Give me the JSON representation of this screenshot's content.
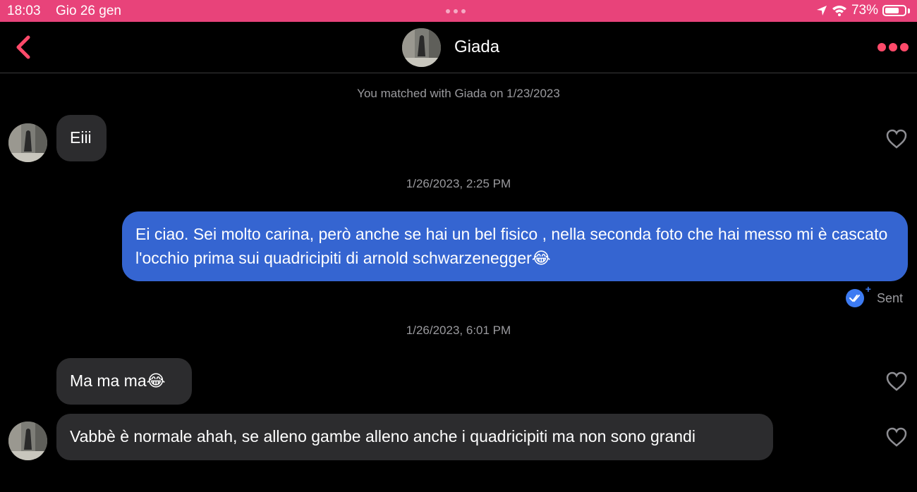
{
  "status_bar": {
    "time": "18:03",
    "date": "Gio 26 gen",
    "battery": "73%",
    "battery_level": 0.73
  },
  "header": {
    "name": "Giada"
  },
  "match_notice": "You matched with Giada on 1/23/2023",
  "messages": [
    {
      "type": "received",
      "text": "Eiii"
    },
    {
      "type": "timestamp",
      "text": "1/26/2023, 2:25 PM"
    },
    {
      "type": "sent",
      "text": "Ei ciao. Sei molto carina, però anche se hai un bel fisico , nella seconda foto che hai messo mi è cascato l'occhio prima sui quadricipiti di arnold schwarzenegger😂",
      "status": "Sent"
    },
    {
      "type": "timestamp",
      "text": "1/26/2023, 6:01 PM"
    },
    {
      "type": "received",
      "text": "Ma ma ma😂"
    },
    {
      "type": "received",
      "text": "Vabbè è normale ahah, se alleno gambe alleno anche i quadricipiti ma non sono grandi"
    }
  ],
  "colors": {
    "status_bar": "#e8437a",
    "accent": "#fe4a6a",
    "sent_bubble": "#3565d1",
    "received_bubble": "#2c2c2e"
  }
}
